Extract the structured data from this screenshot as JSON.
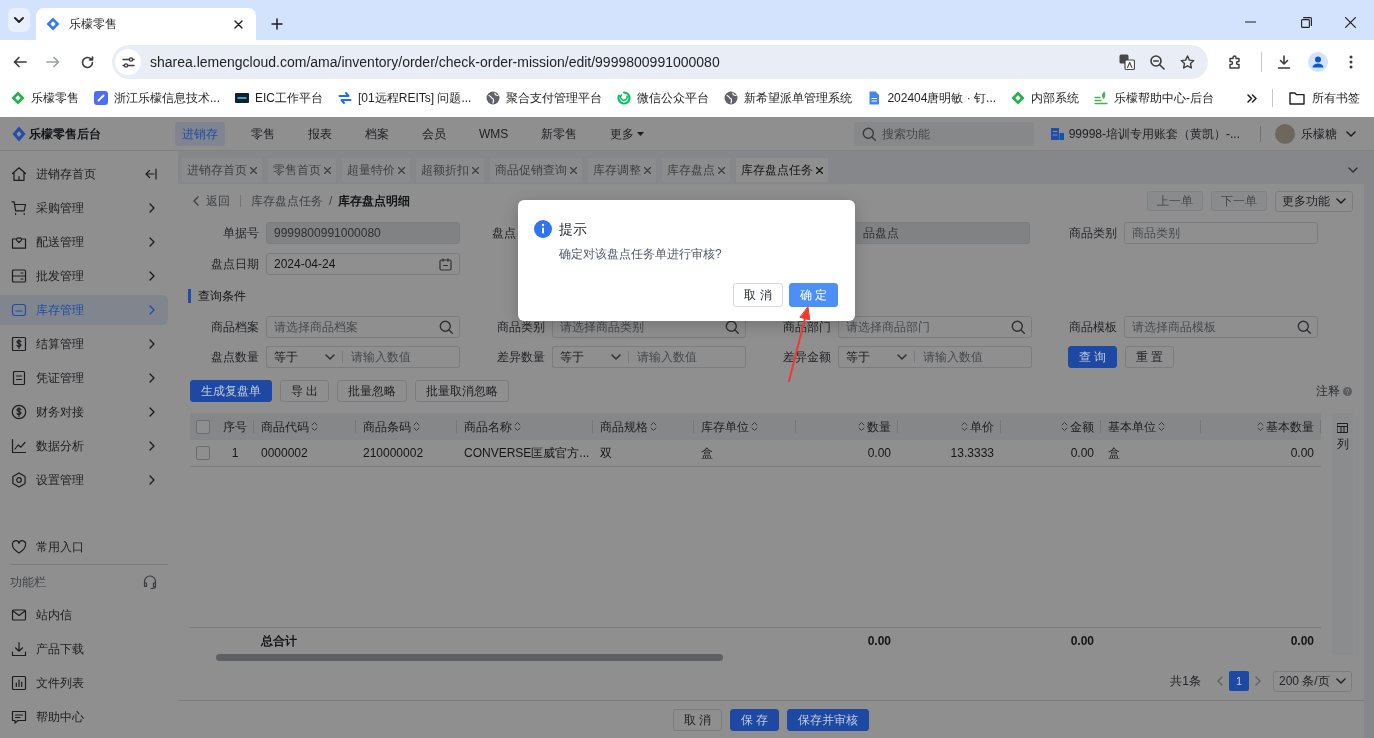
{
  "browser": {
    "tabs": [
      {
        "title": "乐檬零售",
        "selected": true
      }
    ],
    "url": "sharea.lemengcloud.com/ama/inventory/order/check-order-mission/edit/9999800991000080",
    "bookmarks": [
      {
        "label": "乐檬零售"
      },
      {
        "label": "浙江乐檬信息技术..."
      },
      {
        "label": "EIC工作平台"
      },
      {
        "label": "[01远程REITs] 问题..."
      },
      {
        "label": "聚合支付管理平台"
      },
      {
        "label": "微信公众平台"
      },
      {
        "label": "新希望派单管理系统"
      },
      {
        "label": "202404唐明敏 · 钉..."
      },
      {
        "label": "内部系统"
      },
      {
        "label": "乐檬帮助中心-后台"
      }
    ],
    "all_bookmarks": "所有书签"
  },
  "header": {
    "app_name": "乐檬零售后台",
    "nav": [
      {
        "label": "进销存",
        "selected": true,
        "dropdown": false
      },
      {
        "label": "零售",
        "selected": false,
        "dropdown": false
      },
      {
        "label": "报表",
        "selected": false,
        "dropdown": false
      },
      {
        "label": "档案",
        "selected": false,
        "dropdown": false
      },
      {
        "label": "会员",
        "selected": false,
        "dropdown": false
      },
      {
        "label": "WMS",
        "selected": false,
        "dropdown": false
      },
      {
        "label": "新零售",
        "selected": false,
        "dropdown": false
      },
      {
        "label": "更多",
        "selected": false,
        "dropdown": true
      }
    ],
    "search": {
      "placeholder": "搜索功能"
    },
    "account": "99998-培训专用账套（黄凯）-...",
    "user": "乐檬糖"
  },
  "sidebar": {
    "items": [
      {
        "label": "进销存首页",
        "selected": false
      },
      {
        "label": "采购管理",
        "selected": false
      },
      {
        "label": "配送管理",
        "selected": false
      },
      {
        "label": "批发管理",
        "selected": false
      },
      {
        "label": "库存管理",
        "selected": true
      },
      {
        "label": "结算管理",
        "selected": false
      },
      {
        "label": "凭证管理",
        "selected": false
      },
      {
        "label": "财务对接",
        "selected": false
      },
      {
        "label": "数据分析",
        "selected": false
      },
      {
        "label": "设置管理",
        "selected": false
      }
    ],
    "favorites": "常用入口",
    "function_bar": {
      "title": "功能栏",
      "items": [
        "站内信",
        "产品下载",
        "文件列表",
        "帮助中心"
      ]
    }
  },
  "page_tabs": [
    {
      "label": "进销存首页",
      "selected": false
    },
    {
      "label": "零售首页",
      "selected": false
    },
    {
      "label": "超量特价",
      "selected": false
    },
    {
      "label": "超额折扣",
      "selected": false
    },
    {
      "label": "商品促销查询",
      "selected": false
    },
    {
      "label": "库存调整",
      "selected": false
    },
    {
      "label": "库存盘点",
      "selected": false
    },
    {
      "label": "库存盘点任务",
      "selected": true
    }
  ],
  "breadcrumb": {
    "back": "返回",
    "path": [
      "库存盘点任务",
      "库存盘点明细"
    ],
    "separator": "/"
  },
  "record_nav": [
    {
      "label": "上一单",
      "disabled": true
    },
    {
      "label": "下一单",
      "disabled": true
    }
  ],
  "more_menu": "更多功能",
  "header_fields": [
    {
      "label": "单据号",
      "value": "9999800991000080",
      "disabled": true
    },
    {
      "label": "盘点"
    },
    {
      "value": "品盘点",
      "disabled": true
    },
    {
      "label": "商品类别",
      "placeholder": "商品类别",
      "disabled": false
    }
  ],
  "date_field": {
    "label": "盘点日期",
    "value": "2024-04-24"
  },
  "query": {
    "title": "查询条件",
    "search_fields": [
      {
        "label": "商品档案",
        "placeholder": "请选择商品档案"
      },
      {
        "label": "商品类别",
        "placeholder": "请选择商品类别"
      },
      {
        "label": "商品部门",
        "placeholder": "请选择商品部门"
      },
      {
        "label": "商品模板",
        "placeholder": "请选择商品模板"
      }
    ],
    "compare_fields": [
      {
        "label": "盘点数量",
        "operator": "等于",
        "placeholder": "请输入数值"
      },
      {
        "label": "差异数量",
        "operator": "等于",
        "placeholder": "请输入数值"
      },
      {
        "label": "差异金额",
        "operator": "等于",
        "placeholder": "请输入数值"
      }
    ],
    "buttons": [
      {
        "label": "查 询",
        "primary": true
      },
      {
        "label": "重 置",
        "primary": false
      }
    ]
  },
  "toolbar": {
    "buttons": [
      {
        "label": "生成复盘单",
        "primary": true
      },
      {
        "label": "导 出",
        "primary": false
      },
      {
        "label": "批量忽略",
        "primary": false
      },
      {
        "label": "批量取消忽略",
        "primary": false
      }
    ],
    "note": "注释"
  },
  "table": {
    "header_checked": false,
    "columns": [
      {
        "label": "序号",
        "kind": "index",
        "sortable": false
      },
      {
        "label": "商品代码",
        "kind": "text",
        "sortable": true,
        "total": "总合计"
      },
      {
        "label": "商品条码",
        "kind": "text",
        "sortable": true
      },
      {
        "label": "商品名称",
        "kind": "text",
        "sortable": true
      },
      {
        "label": "商品规格",
        "kind": "text",
        "sortable": true
      },
      {
        "label": "库存单位",
        "kind": "text",
        "sortable": true
      },
      {
        "label": "数量",
        "kind": "number",
        "sortable": true,
        "total": "0.00"
      },
      {
        "label": "单价",
        "kind": "number",
        "sortable": true
      },
      {
        "label": "金额",
        "kind": "number",
        "sortable": true,
        "total": "0.00"
      },
      {
        "label": "基本单位",
        "kind": "text",
        "sortable": true
      },
      {
        "label": "基本数量",
        "kind": "number",
        "sortable": true,
        "total": "0.00"
      }
    ],
    "rows": [
      {
        "checked": false,
        "cells": [
          "1",
          "0000002",
          "210000002",
          "CONVERSE匡威官方...",
          "双",
          "盒",
          "0.00",
          "13.3333",
          "0.00",
          "盒",
          "0.00"
        ]
      }
    ],
    "settings": "列"
  },
  "pagination": {
    "total": "共1条",
    "pages": [
      {
        "label": "1",
        "selected": true
      }
    ],
    "page_size": "200 条/页"
  },
  "footer": {
    "buttons": [
      {
        "label": "取 消",
        "primary": false
      },
      {
        "label": "保 存",
        "primary": true
      },
      {
        "label": "保存并审核",
        "primary": true
      }
    ]
  },
  "dialog": {
    "title": "提示",
    "message": "确定对该盘点任务单进行审核?",
    "buttons": [
      {
        "label": "取 消",
        "primary": false
      },
      {
        "label": "确 定",
        "primary": true
      }
    ]
  }
}
